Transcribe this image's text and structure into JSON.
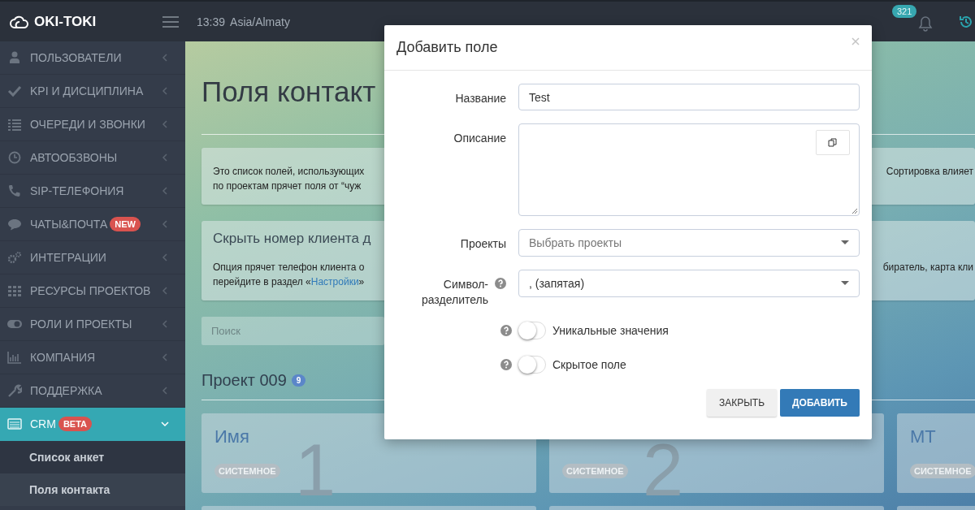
{
  "topbar": {
    "logo": "OKI-TOKI",
    "time": "13:39",
    "timezone": "Asia/Almaty",
    "notifications": "321"
  },
  "sidebar": {
    "items": [
      {
        "label": "ПОЛЬЗОВАТЕЛИ",
        "selected": false,
        "expanded": false
      },
      {
        "label": "KPI И ДИСЦИПЛИНА",
        "selected": false,
        "expanded": false
      },
      {
        "label": "ОЧЕРЕДИ И ЗВОНКИ",
        "selected": false,
        "expanded": false
      },
      {
        "label": "АВТООБЗВОНЫ",
        "selected": false,
        "expanded": false
      },
      {
        "label": "SIP-ТЕЛЕФОНИЯ",
        "selected": false,
        "expanded": false
      },
      {
        "label": "ЧАТЫ&ПОЧТА",
        "badge": "NEW",
        "selected": false,
        "expanded": false
      },
      {
        "label": "ИНТЕГРАЦИИ",
        "selected": false,
        "expanded": false
      },
      {
        "label": "РЕСУРСЫ ПРОЕКТОВ",
        "selected": false,
        "expanded": false
      },
      {
        "label": "РОЛИ И ПРОЕКТЫ",
        "selected": false,
        "expanded": false
      },
      {
        "label": "КОМПАНИЯ",
        "selected": false,
        "expanded": false
      },
      {
        "label": "ПОДДЕРЖКА",
        "selected": false,
        "expanded": false
      },
      {
        "label": "CRM",
        "badge": "BETA",
        "selected": true,
        "expanded": true
      }
    ],
    "subitems": [
      {
        "label": "Список анкет",
        "selected": false
      },
      {
        "label": "Поля контакта",
        "selected": true
      }
    ]
  },
  "page": {
    "title": "Поля контакт",
    "info": {
      "lines": [
        "Это список полей, использующих",
        "по проектам прячет поля от “чуж"
      ],
      "right": "Сортировка влияет"
    },
    "option": {
      "title": "Скрыть номер клиента д",
      "line1": "Опция прячет телефон клиента о",
      "line2": {
        "before": "перейдите в раздел «",
        "link": "Настройки",
        "after": "»"
      },
      "right": "биратель, карта кли"
    },
    "search": {
      "placeholder": "Поиск"
    },
    "project": {
      "name": "Проект 009",
      "count": "9"
    },
    "cards": [
      {
        "title": "Имя",
        "tag": "СИСТЕМНОЕ",
        "number": "1"
      },
      {
        "tag": "СИСТЕМНОЕ",
        "number": "2"
      },
      {
        "title": "МТ",
        "tag": "СИСТЕМНОЕ"
      }
    ]
  },
  "modal": {
    "title": "Добавить поле",
    "fields": [
      {
        "kind": "text",
        "label": "Название",
        "value": "Test"
      },
      {
        "kind": "textarea",
        "label": "Описание"
      },
      {
        "kind": "select",
        "label": "Проекты",
        "placeholder": "Выбрать проекты"
      },
      {
        "kind": "select",
        "label": "Символ-разделитель",
        "value": ", (запятая)",
        "help": true
      }
    ],
    "toggles": [
      {
        "label": "Уникальные значения",
        "on": false
      },
      {
        "label": "Скрытое поле",
        "on": false
      }
    ],
    "buttons": [
      {
        "label": "ЗАКРЫТЬ",
        "kind": "default"
      },
      {
        "label": "ДОБАВИТЬ",
        "kind": "primary"
      }
    ]
  }
}
